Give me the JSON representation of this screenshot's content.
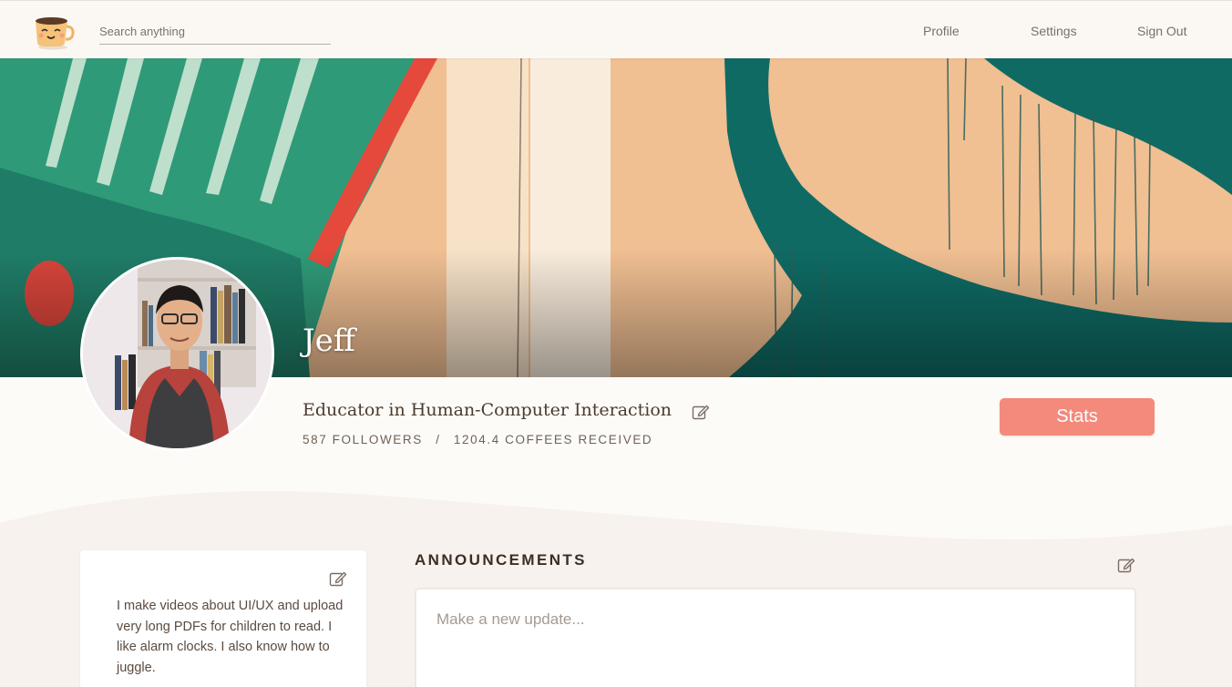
{
  "header": {
    "logo_icon": "coffee-cup-icon",
    "search": {
      "placeholder": "Search anything",
      "value": ""
    },
    "nav": [
      {
        "label": "Profile"
      },
      {
        "label": "Settings"
      },
      {
        "label": "Sign Out"
      }
    ]
  },
  "profile": {
    "name": "Jeff",
    "title": "Educator in Human-Computer Interaction",
    "followers": "587 FOLLOWERS",
    "separator": "/",
    "coffees": "1204.4 COFFEES RECEIVED",
    "stats_button": "Stats",
    "edit_icon": "pencil-square-icon"
  },
  "about": {
    "text": "I make videos about UI/UX and upload very long PDFs for children to read. I like alarm clocks. I also know how to juggle."
  },
  "announcements": {
    "heading": "ANNOUNCEMENTS",
    "placeholder": "Make a new update..."
  },
  "colors": {
    "accent": "#f38a7c",
    "banner_teal": "#0f6a64",
    "banner_green": "#2d9f78",
    "banner_peach": "#f0bf92",
    "banner_red": "#e5493c",
    "background": "#fdfbf8",
    "section_bg": "#f7f2ed"
  }
}
